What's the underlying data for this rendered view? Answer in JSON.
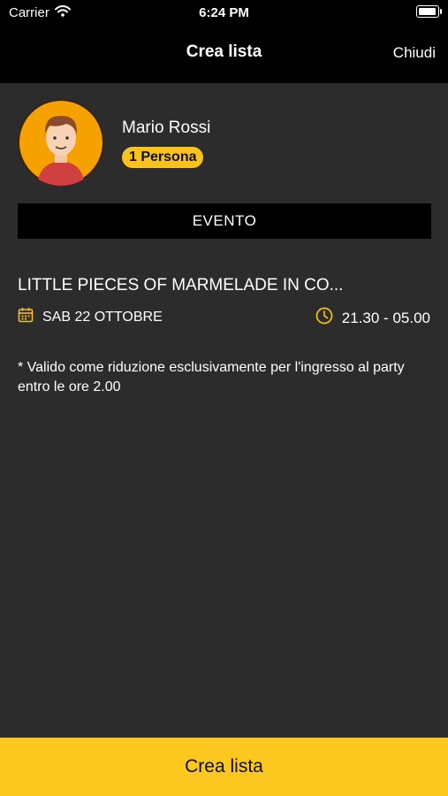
{
  "status_bar": {
    "carrier": "Carrier",
    "time": "6:24 PM"
  },
  "nav": {
    "title": "Crea lista",
    "close_label": "Chiudi"
  },
  "profile": {
    "name": "Mario Rossi",
    "persons": "1 Persona"
  },
  "section": {
    "label": "EVENTO"
  },
  "event": {
    "title": "LITTLE PIECES OF MARMELADE IN CO...",
    "date": "SAB 22 OTTOBRE",
    "time": "21.30 - 05.00",
    "note": "* Valido come riduzione esclusivamente per l'ingresso al party entro le ore 2.00"
  },
  "footer": {
    "button_label": "Crea lista"
  },
  "colors": {
    "accent": "#fcc71f",
    "background": "#2c2c2c",
    "bar": "#000000"
  },
  "icons": [
    "wifi-icon",
    "battery-icon",
    "calendar-icon",
    "clock-icon"
  ]
}
